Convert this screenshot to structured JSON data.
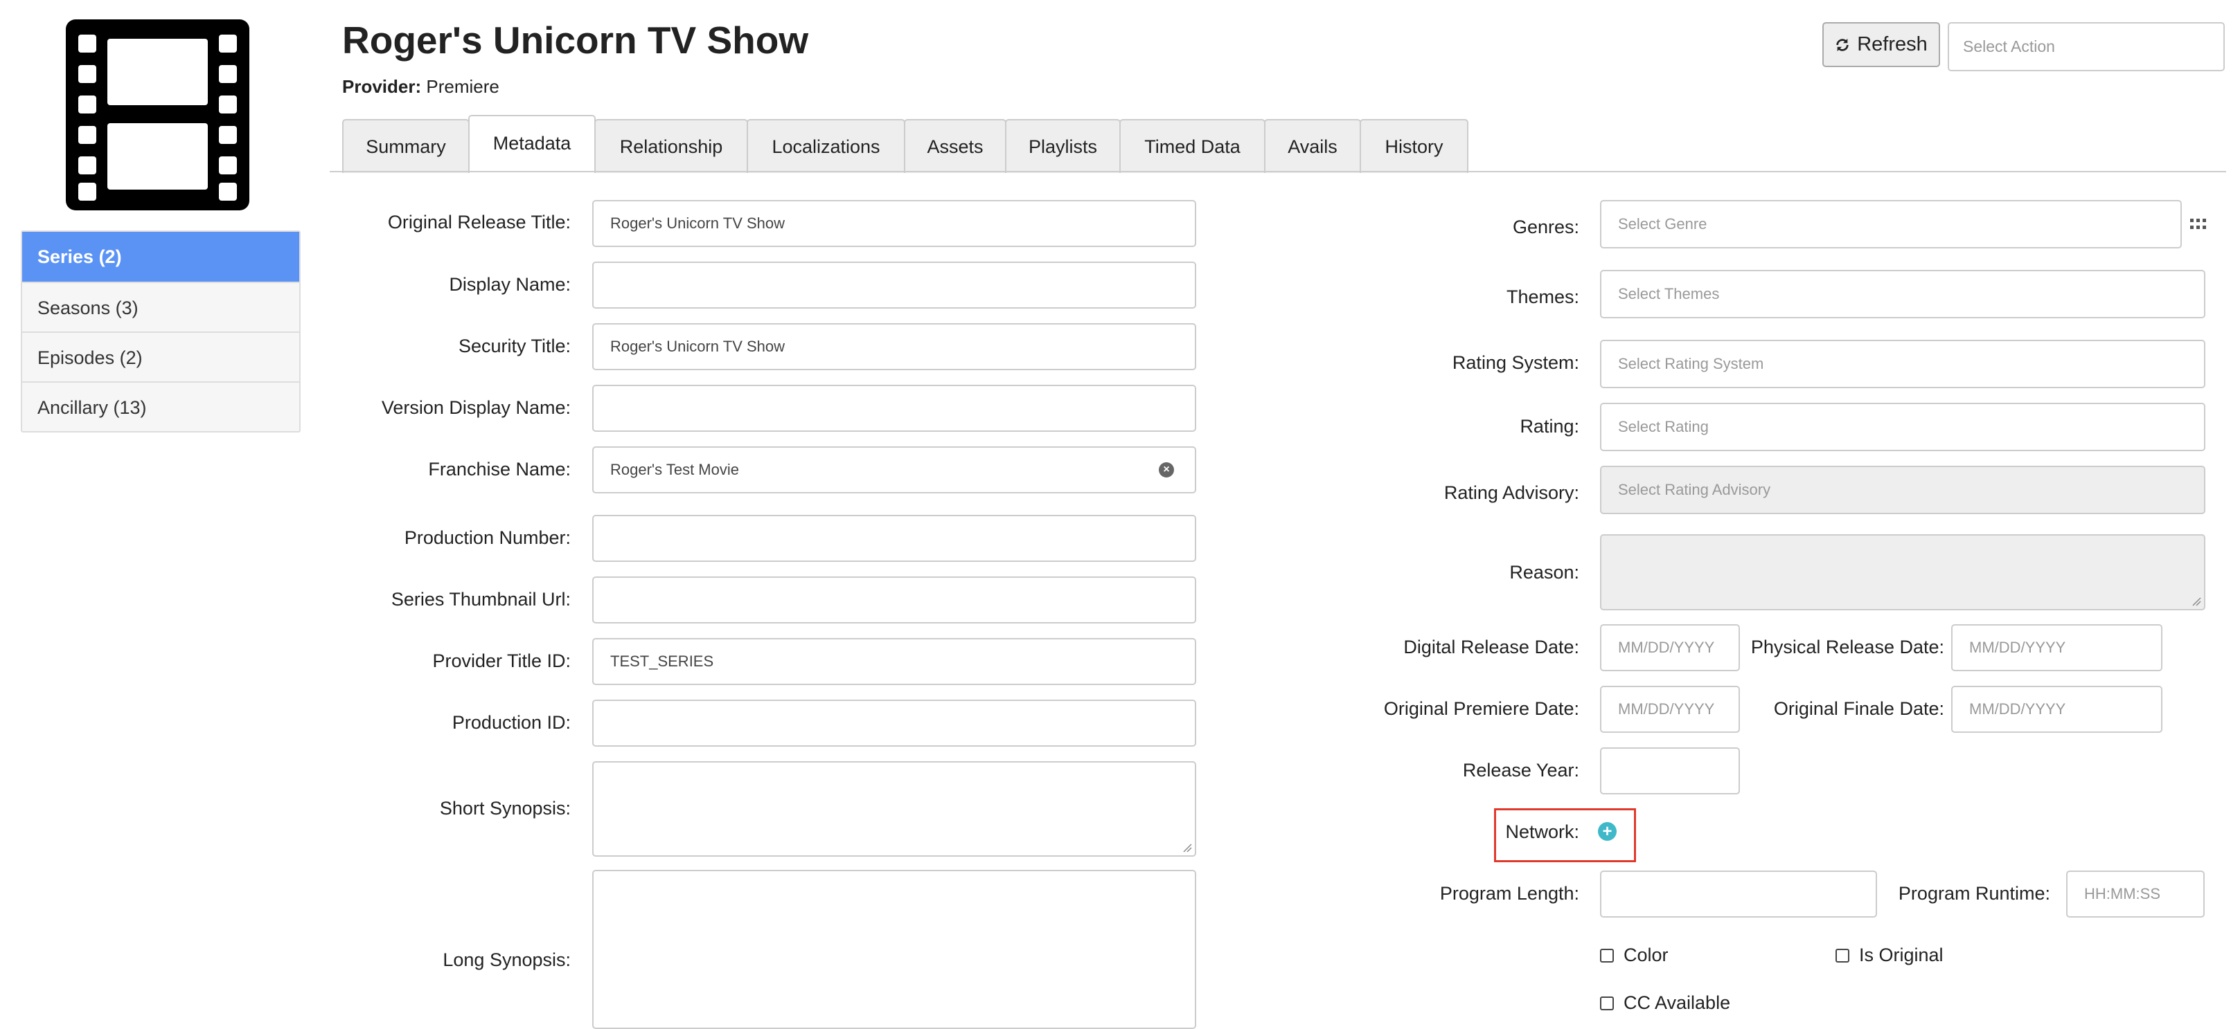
{
  "header": {
    "title": "Roger's Unicorn TV Show",
    "provider_label": "Provider:",
    "provider_value": "Premiere",
    "refresh_label": "Refresh",
    "action_placeholder": "Select Action"
  },
  "sidebar": {
    "items": [
      {
        "label": "Series (2)",
        "active": true
      },
      {
        "label": "Seasons (3)"
      },
      {
        "label": "Episodes (2)"
      },
      {
        "label": "Ancillary (13)"
      }
    ]
  },
  "tabs": [
    "Summary",
    "Metadata",
    "Relationship",
    "Localizations",
    "Assets",
    "Playlists",
    "Timed Data",
    "Avails",
    "History"
  ],
  "active_tab": "Metadata",
  "left_form": {
    "original_release_title": {
      "label": "Original Release Title:",
      "value": "Roger's Unicorn TV Show"
    },
    "display_name": {
      "label": "Display Name:",
      "value": ""
    },
    "security_title": {
      "label": "Security Title:",
      "value": "Roger's Unicorn TV Show"
    },
    "version_display_name": {
      "label": "Version Display Name:",
      "value": ""
    },
    "franchise_name": {
      "label": "Franchise Name:",
      "value": "Roger's Test Movie"
    },
    "production_number": {
      "label": "Production Number:",
      "value": ""
    },
    "series_thumbnail_url": {
      "label": "Series Thumbnail Url:",
      "value": ""
    },
    "provider_title_id": {
      "label": "Provider Title ID:",
      "value": "TEST_SERIES"
    },
    "production_id": {
      "label": "Production ID:",
      "value": ""
    },
    "short_synopsis": {
      "label": "Short Synopsis:",
      "value": ""
    },
    "long_synopsis": {
      "label": "Long Synopsis:",
      "value": ""
    }
  },
  "right_form": {
    "genres": {
      "label": "Genres:",
      "placeholder": "Select Genre"
    },
    "themes": {
      "label": "Themes:",
      "placeholder": "Select Themes"
    },
    "rating_system": {
      "label": "Rating System:",
      "placeholder": "Select Rating System"
    },
    "rating": {
      "label": "Rating:",
      "placeholder": "Select Rating"
    },
    "rating_advisory": {
      "label": "Rating Advisory:",
      "placeholder": "Select Rating Advisory"
    },
    "reason": {
      "label": "Reason:"
    },
    "digital_release_date": {
      "label": "Digital Release Date:",
      "placeholder": "MM/DD/YYYY"
    },
    "physical_release_date": {
      "label": "Physical Release Date:",
      "placeholder": "MM/DD/YYYY"
    },
    "original_premiere_date": {
      "label": "Original Premiere Date:",
      "placeholder": "MM/DD/YYYY"
    },
    "original_finale_date": {
      "label": "Original Finale Date:",
      "placeholder": "MM/DD/YYYY"
    },
    "release_year": {
      "label": "Release Year:"
    },
    "network": {
      "label": "Network:"
    },
    "program_length": {
      "label": "Program Length:"
    },
    "program_runtime": {
      "label": "Program Runtime:",
      "placeholder": "HH:MM:SS"
    },
    "checkboxes": {
      "color": "Color",
      "is_original": "Is Original",
      "cc_available": "CC Available"
    }
  },
  "colors": {
    "active_nav": "#5b93f5",
    "highlight_border": "#e0392b",
    "add_icon": "#3fb8c9"
  },
  "icons": [
    "film-strip-icon",
    "refresh-icon",
    "clear-icon",
    "grid-icon",
    "plus-circle-icon"
  ]
}
